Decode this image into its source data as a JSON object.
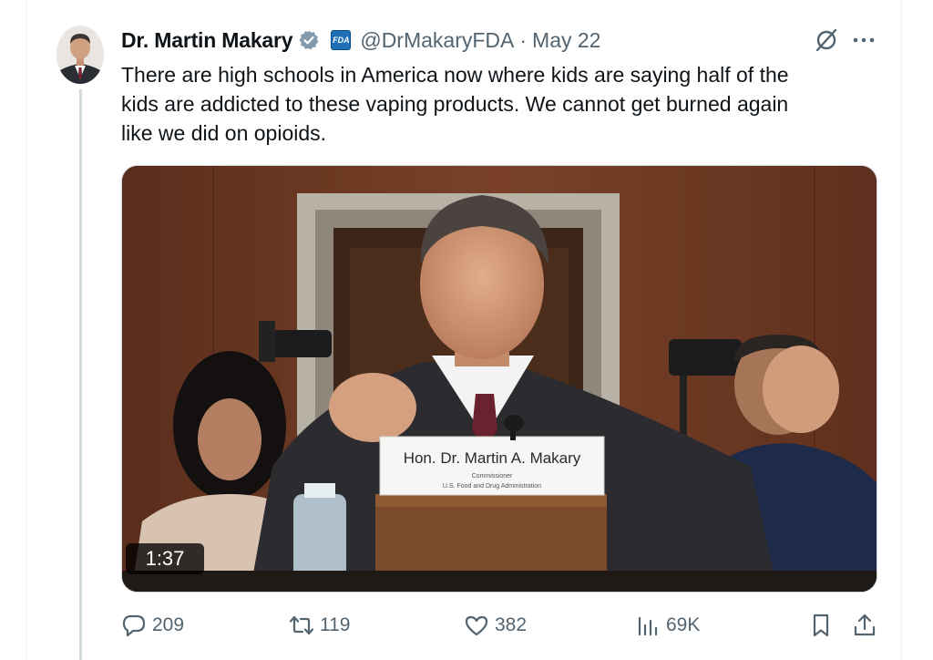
{
  "tweet": {
    "author": {
      "display_name": "Dr. Martin Makary",
      "handle": "@DrMakaryFDA",
      "affiliation_badge": "FDA",
      "verified": true
    },
    "separator": "·",
    "date": "May 22",
    "text": "There are high schools in America now where kids are saying half of the\nkids are addicted to these vaping products. We cannot get burned again\nlike we did on opioids.",
    "media": {
      "duration": "1:37",
      "nameplate": {
        "name": "Hon. Dr. Martin A. Makary",
        "title": "Commissioner",
        "agency": "U.S. Food and Drug Administration"
      }
    },
    "stats": {
      "replies": "209",
      "reposts": "119",
      "likes": "382",
      "views": "69K"
    }
  },
  "colors": {
    "text_primary": "#0f1419",
    "text_secondary": "#536471",
    "verified_badge": "#829aab",
    "thread_line": "#cfd9de"
  },
  "icons": {
    "verified": "verified-badge-icon",
    "grok": "grok-icon",
    "more": "more-icon",
    "reply": "reply-icon",
    "repost": "repost-icon",
    "like": "heart-icon",
    "views": "views-icon",
    "bookmark": "bookmark-icon",
    "share": "share-icon"
  }
}
